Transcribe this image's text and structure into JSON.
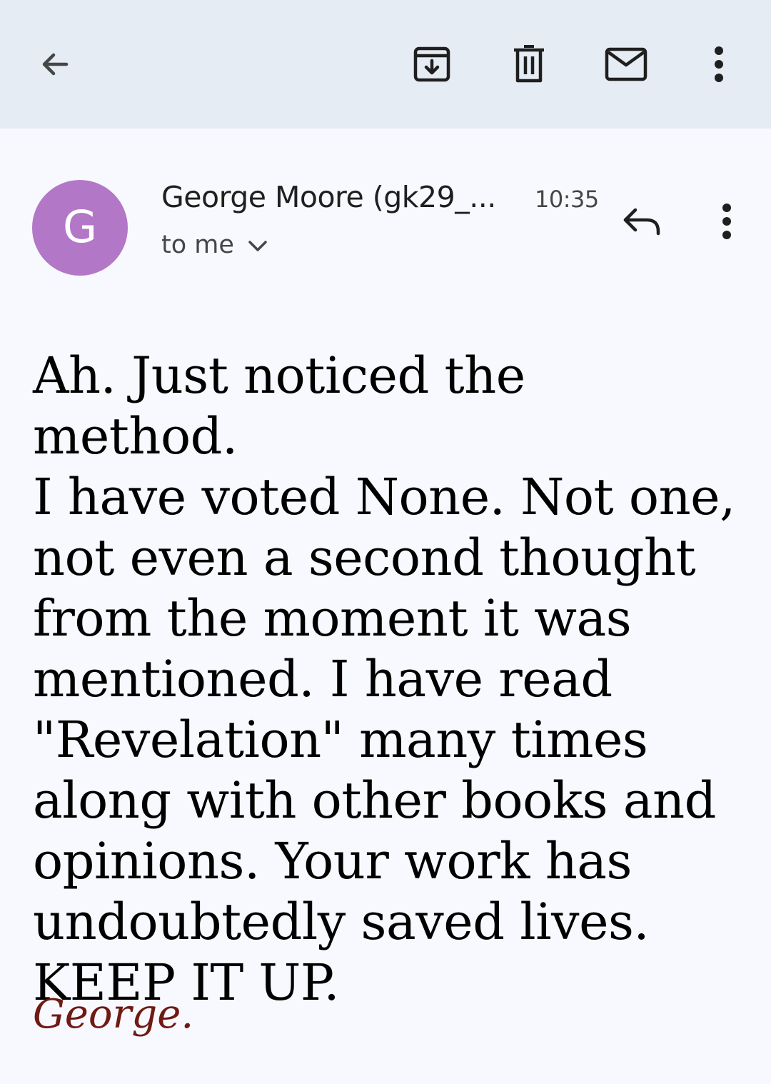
{
  "toolbar": {
    "back": {
      "icon": "arrow-left-icon",
      "label": "Back"
    },
    "archive": {
      "icon": "archive-icon",
      "label": "Archive"
    },
    "delete": {
      "icon": "trash-icon",
      "label": "Delete"
    },
    "mark_unread": {
      "icon": "mail-icon",
      "label": "Mark as unread"
    },
    "more": {
      "icon": "more-vert-icon",
      "label": "More options"
    }
  },
  "message": {
    "avatar_letter": "G",
    "avatar_color": "#b377c8",
    "sender": "George Moore (gk29_...",
    "time": "10:35",
    "recipient": "to me",
    "reply_icon": "reply-icon",
    "more_icon": "more-vert-icon",
    "body": "Ah. Just noticed the method.\nI have voted None. Not one,\nnot even a second thought\nfrom the moment it was\nmentioned. I have read\n\"Revelation\" many times\nalong with other books and\nopinions. Your work has\nundoubtedly saved lives.\nKEEP IT UP.",
    "signature": "George.",
    "signature_color": "#6f1a12"
  },
  "colors": {
    "toolbar_bg": "#e6ecf3",
    "page_bg": "#f8f9fe",
    "icon": "#444746"
  }
}
